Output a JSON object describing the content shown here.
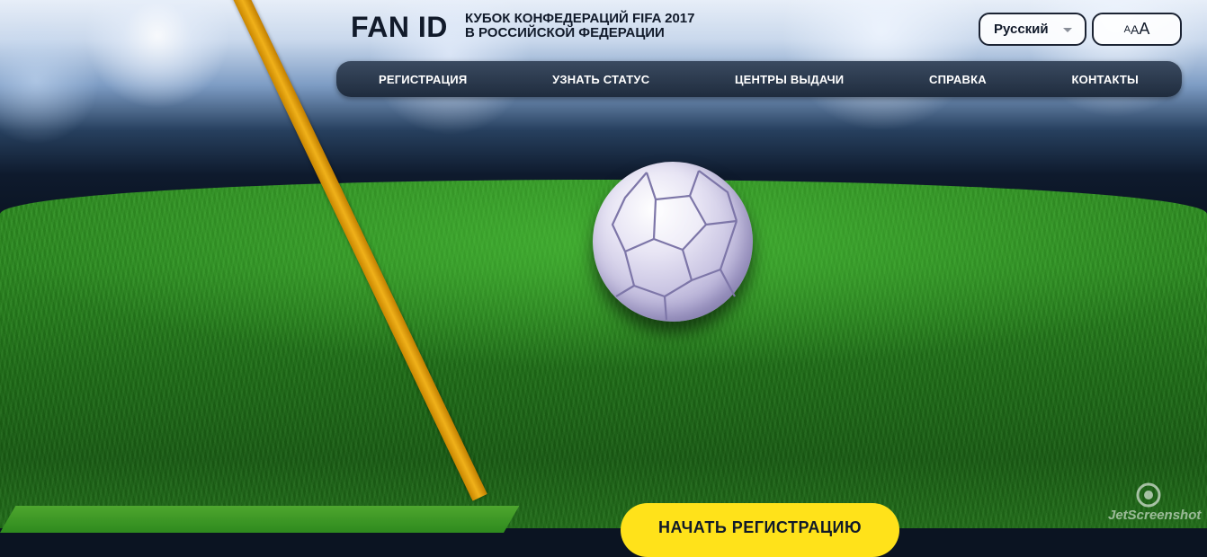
{
  "header": {
    "logo": "FAN ID",
    "subtitle_line1": "КУБОК КОНФЕДЕРАЦИЙ FIFA 2017",
    "subtitle_line2": "В РОССИЙСКОЙ ФЕДЕРАЦИИ",
    "language": {
      "selected": "Русский",
      "icon": "chevron-down-icon"
    },
    "font_size": {
      "small": "A",
      "medium": "A",
      "large": "A"
    }
  },
  "nav": {
    "items": [
      {
        "label": "РЕГИСТРАЦИЯ"
      },
      {
        "label": "УЗНАТЬ СТАТУС"
      },
      {
        "label": "ЦЕНТРЫ ВЫДАЧИ"
      },
      {
        "label": "СПРАВКА"
      },
      {
        "label": "КОНТАКТЫ"
      }
    ]
  },
  "hero": {
    "cta_label": "НАЧАТЬ РЕГИСТРАЦИЮ",
    "accent_color": "#f0b11a",
    "cta_color": "#ffe21a"
  },
  "watermark": {
    "text": "JetScreenshot",
    "icon": "camera-lens-icon"
  }
}
